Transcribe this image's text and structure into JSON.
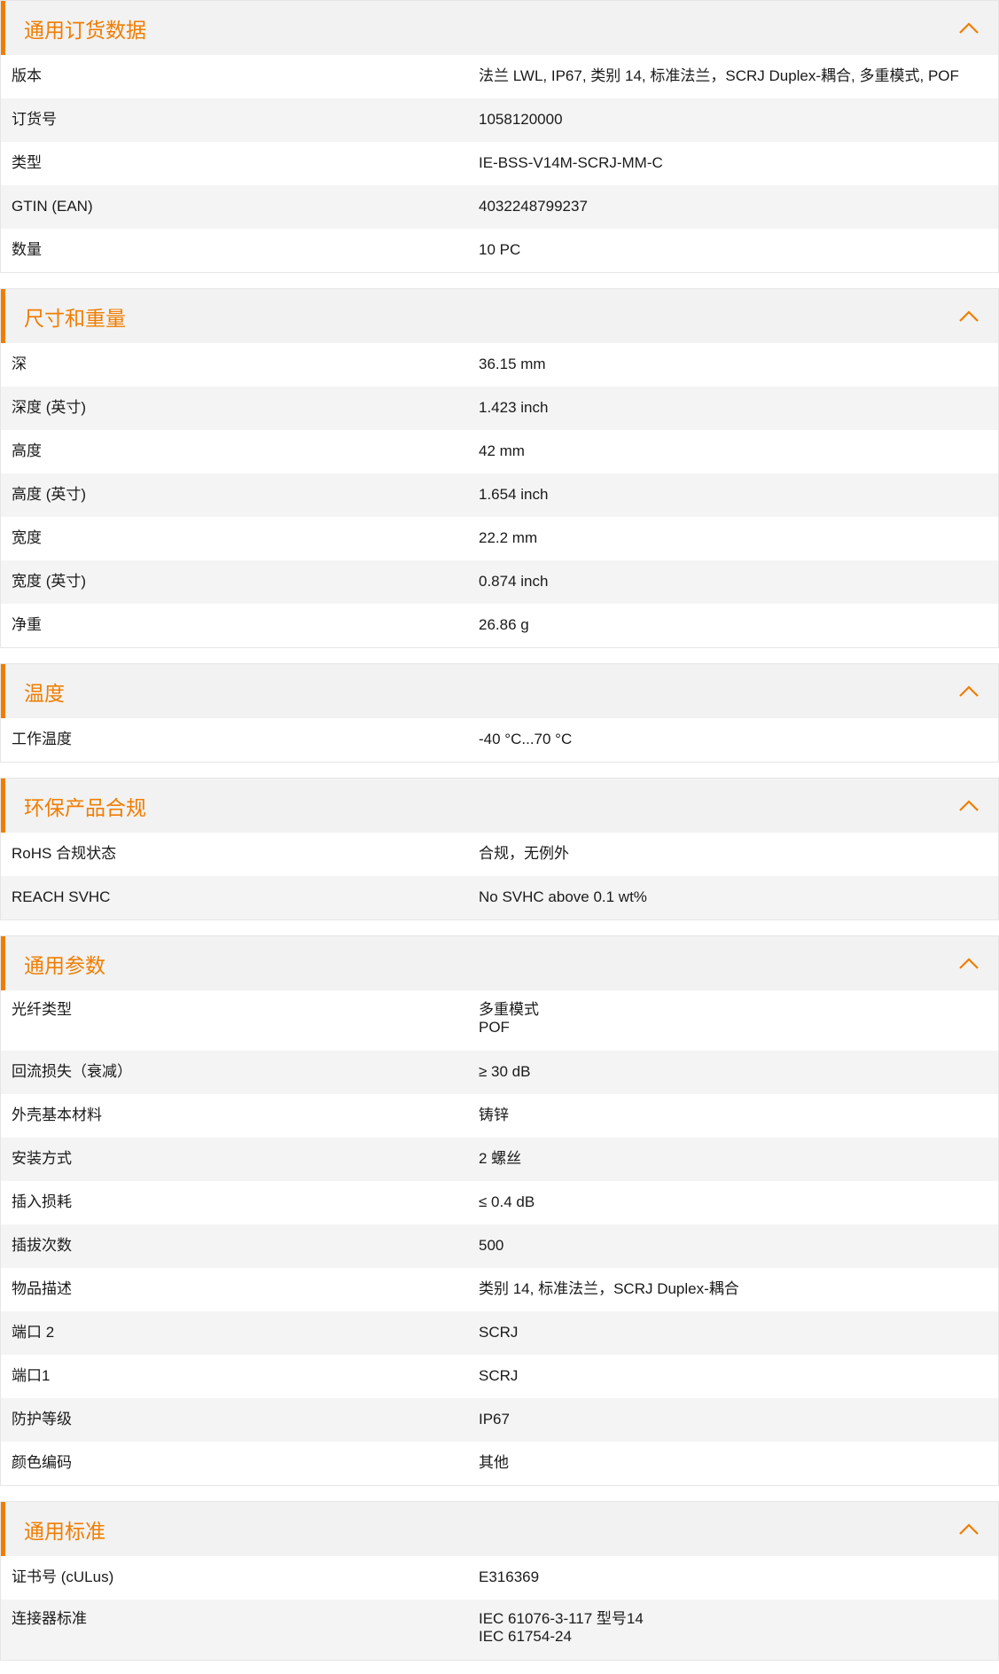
{
  "colors": {
    "accent": "#f07d00",
    "header_bg": "#f2f2f2",
    "row_alt": "#f4f4f4"
  },
  "icons": {
    "collapse": "chevron-up-icon"
  },
  "sections": [
    {
      "title": "通用订货数据",
      "rows": [
        {
          "label": "版本",
          "values": [
            "法兰 LWL, IP67, 类别 14, 标准法兰，SCRJ Duplex-耦合, 多重模式, POF"
          ]
        },
        {
          "label": "订货号",
          "values": [
            "1058120000"
          ]
        },
        {
          "label": "类型",
          "values": [
            "IE-BSS-V14M-SCRJ-MM-C"
          ]
        },
        {
          "label": "GTIN (EAN)",
          "values": [
            "4032248799237"
          ]
        },
        {
          "label": "数量",
          "values": [
            "10  PC"
          ]
        }
      ]
    },
    {
      "title": "尺寸和重量",
      "rows": [
        {
          "label": "深",
          "values": [
            "36.15  mm"
          ]
        },
        {
          "label": "深度 (英寸)",
          "values": [
            "1.423  inch"
          ]
        },
        {
          "label": "高度",
          "values": [
            "42  mm"
          ]
        },
        {
          "label": "高度 (英寸)",
          "values": [
            "1.654  inch"
          ]
        },
        {
          "label": "宽度",
          "values": [
            "22.2  mm"
          ]
        },
        {
          "label": "宽度 (英寸)",
          "values": [
            "0.874  inch"
          ]
        },
        {
          "label": "净重",
          "values": [
            "26.86  g"
          ]
        }
      ]
    },
    {
      "title": "温度",
      "rows": [
        {
          "label": "工作温度",
          "values": [
            "-40 °C...70 °C"
          ]
        }
      ]
    },
    {
      "title": "环保产品合规",
      "rows": [
        {
          "label": "RoHS 合规状态",
          "values": [
            "合规，无例外"
          ]
        },
        {
          "label": "REACH SVHC",
          "values": [
            "No SVHC above 0.1 wt%"
          ]
        }
      ]
    },
    {
      "title": "通用参数",
      "rows": [
        {
          "label": "光纤类型",
          "values": [
            "多重模式",
            "POF"
          ]
        },
        {
          "label": "回流损失（衰减）",
          "values": [
            "≥ 30 dB"
          ]
        },
        {
          "label": "外壳基本材料",
          "values": [
            "铸锌"
          ]
        },
        {
          "label": "安装方式",
          "values": [
            "2 螺丝"
          ]
        },
        {
          "label": "插入损耗",
          "values": [
            "≤ 0.4 dB"
          ]
        },
        {
          "label": "插拔次数",
          "values": [
            "500"
          ]
        },
        {
          "label": "物品描述",
          "values": [
            "类别 14, 标准法兰，SCRJ Duplex-耦合"
          ]
        },
        {
          "label": "端口 2",
          "values": [
            "SCRJ"
          ]
        },
        {
          "label": "端口1",
          "values": [
            "SCRJ"
          ]
        },
        {
          "label": "防护等级",
          "values": [
            "IP67"
          ]
        },
        {
          "label": "颜色编码",
          "values": [
            "其他"
          ]
        }
      ]
    },
    {
      "title": "通用标准",
      "rows": [
        {
          "label": "证书号 (cULus)",
          "values": [
            "E316369"
          ]
        },
        {
          "label": "连接器标准",
          "values": [
            "IEC 61076-3-117 型号14",
            "IEC 61754-24"
          ]
        }
      ]
    }
  ]
}
